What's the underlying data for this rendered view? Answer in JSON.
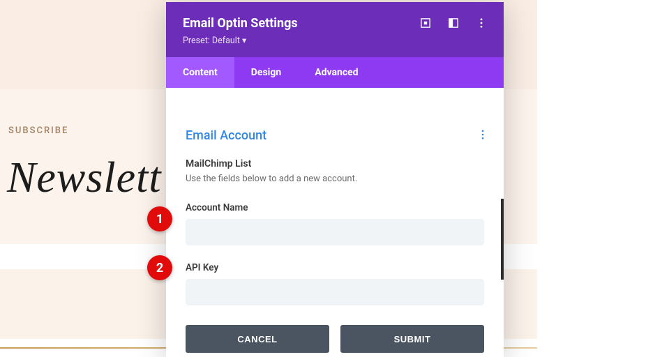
{
  "background": {
    "subscribe_label": "SUBSCRIBE",
    "newsletter_text": "Newslett"
  },
  "modal": {
    "title": "Email Optin Settings",
    "preset_label": "Preset: Default ▾",
    "tabs": {
      "content": "Content",
      "design": "Design",
      "advanced": "Advanced",
      "active": "content"
    },
    "section": {
      "title": "Email Account",
      "list_label": "MailChimp List",
      "help_text": "Use the fields below to add a new account.",
      "fields": {
        "account_name": {
          "label": "Account Name",
          "value": ""
        },
        "api_key": {
          "label": "API Key",
          "value": ""
        }
      },
      "buttons": {
        "cancel": "CANCEL",
        "submit": "SUBMIT"
      }
    }
  },
  "annotations": {
    "a1": "1",
    "a2": "2"
  }
}
